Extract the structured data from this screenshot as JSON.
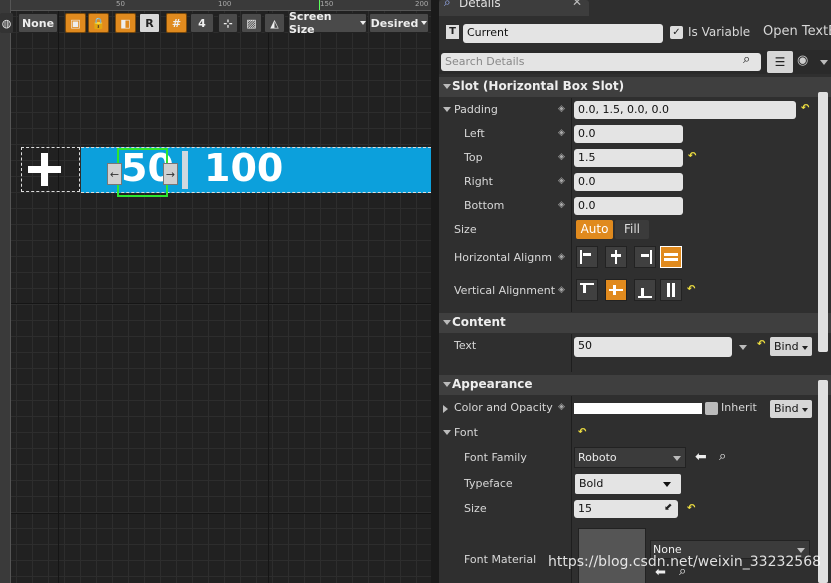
{
  "viewport": {
    "ruler_ticks": [
      "50",
      "100",
      "150",
      "200"
    ],
    "toolbar": {
      "none_label": "None",
      "r_label": "R",
      "grid_count": "4",
      "screen_size_label": "Screen Size",
      "desired_label": "Desired"
    },
    "widget": {
      "value_selected": "50",
      "value_other": "100",
      "left_arrow": "←",
      "right_arrow": "→"
    }
  },
  "details": {
    "tab_title": "Details",
    "widget_name": "Current",
    "is_variable_label": "Is Variable",
    "is_variable_checked": true,
    "open_button": "Open TextB",
    "search_placeholder": "Search Details",
    "slot_section": "Slot (Horizontal Box Slot)",
    "padding": {
      "label": "Padding",
      "value": "0.0, 1.5, 0.0, 0.0",
      "left_label": "Left",
      "left": "0.0",
      "top_label": "Top",
      "top": "1.5",
      "right_label": "Right",
      "right": "0.0",
      "bottom_label": "Bottom",
      "bottom": "0.0"
    },
    "size": {
      "label": "Size",
      "auto": "Auto",
      "fill": "Fill"
    },
    "halign_label": "Horizontal Alignme",
    "valign_label": "Vertical Alignment",
    "content_section": "Content",
    "text": {
      "label": "Text",
      "value": "50",
      "bind": "Bind"
    },
    "appearance_section": "Appearance",
    "color": {
      "label": "Color and Opacity",
      "inherit": "Inherit",
      "bind": "Bind"
    },
    "font": {
      "label": "Font",
      "family_label": "Font Family",
      "family": "Roboto",
      "typeface_label": "Typeface",
      "typeface": "Bold",
      "size_label": "Size",
      "size": "15",
      "material_label": "Font Material",
      "material_value": "None"
    },
    "colors": {
      "accent": "#e08a1e",
      "select": "#2ee62e",
      "hbox": "#0ca0dc"
    }
  },
  "watermark": "https://blog.csdn.net/weixin_33232568"
}
